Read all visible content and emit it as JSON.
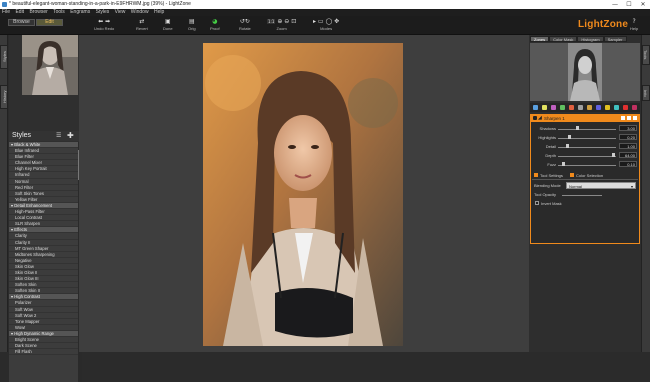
{
  "window": {
    "title": "* beautiful-elegant-woman-standing-in-a-park-in-E9FHRWM.jpg (39%) - LightZone",
    "min": "—",
    "max": "☐",
    "close": "✕"
  },
  "menu": [
    "File",
    "Edit",
    "Browser",
    "Tools",
    "Engrams",
    "Styles",
    "View",
    "Window",
    "Help"
  ],
  "toolbar": {
    "browse": "Browse",
    "edit": "Edit",
    "undo_redo": "Undo Redo",
    "revert": "Revert",
    "done": "Done",
    "orig": "Orig",
    "proof": "Proof",
    "rotate": "Rotate",
    "zoom": "Zoom",
    "zoom_value": "1:1",
    "modes": "Modes",
    "help": "Help"
  },
  "brand": "LightZone",
  "left_tabs": {
    "styles": "Styles",
    "history": "History"
  },
  "styles_panel": {
    "title": "Styles",
    "items": [
      {
        "label": "Black & White",
        "header": true
      },
      {
        "label": "Blue Infrared"
      },
      {
        "label": "Blue Filter"
      },
      {
        "label": "Channel Mixer"
      },
      {
        "label": "High Key Portrait"
      },
      {
        "label": "Infrared"
      },
      {
        "label": "Normal"
      },
      {
        "label": "Red Filter"
      },
      {
        "label": "Soft Skin Tones"
      },
      {
        "label": "Yellow Filter"
      },
      {
        "label": "Detail Enhancement",
        "header": true
      },
      {
        "label": "High-Pass Filter"
      },
      {
        "label": "Local Contrast"
      },
      {
        "label": "SLR Sharpen"
      },
      {
        "label": "Effects",
        "header": true
      },
      {
        "label": "Clarity"
      },
      {
        "label": "Clarity II"
      },
      {
        "label": "MT Green Shaper"
      },
      {
        "label": "Midtones Sharpening"
      },
      {
        "label": "Negative"
      },
      {
        "label": "Skin Glow"
      },
      {
        "label": "Skin Glow II"
      },
      {
        "label": "Skin Glow III"
      },
      {
        "label": "Soften Skin"
      },
      {
        "label": "Soften Skin II"
      },
      {
        "label": "High Contrast",
        "header": true
      },
      {
        "label": "Polarizer"
      },
      {
        "label": "Soft Wow"
      },
      {
        "label": "Soft Wow 2"
      },
      {
        "label": "Tone Mapper"
      },
      {
        "label": "Wow!"
      },
      {
        "label": "High Dynamic Range",
        "header": true
      },
      {
        "label": "Bright Scene"
      },
      {
        "label": "Dark Scene"
      },
      {
        "label": "Fill Flash"
      }
    ]
  },
  "right_tabs": [
    "Zones",
    "Color Mask",
    "Histogram",
    "Sampler"
  ],
  "right_strip": {
    "tools": "Tools",
    "info": "Info"
  },
  "layer": {
    "title": "Sharpen 1",
    "sliders": [
      {
        "label": "Shadows",
        "value": "3.00",
        "pos": 0.32
      },
      {
        "label": "Highlights",
        "value": "0.20",
        "pos": 0.18
      },
      {
        "label": "Detail",
        "value": "1.00",
        "pos": 0.15
      },
      {
        "label": "Depth",
        "value": "64.00",
        "pos": 0.97
      },
      {
        "label": "Fuzz",
        "value": "0.10",
        "pos": 0.08
      }
    ],
    "tool_settings": "Tool Settings",
    "color_selection": "Color Selection",
    "blending_mode_label": "Blending Mode",
    "blending_mode_value": "Normal",
    "tool_opacity_label": "Tool Opacity",
    "invert_mask": "Invert Mask"
  },
  "colors": {
    "accent": "#f08a1c",
    "bg": "#2b2b2b"
  }
}
